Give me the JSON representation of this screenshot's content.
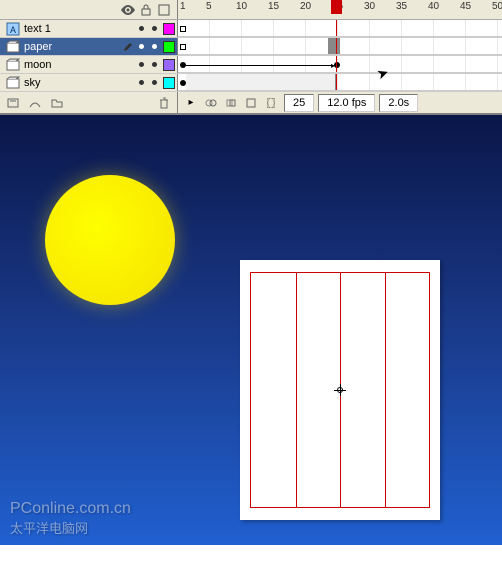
{
  "ruler": {
    "start": 1,
    "step": 5,
    "labels": [
      1,
      5,
      10,
      15,
      20,
      25,
      30,
      35,
      40,
      45,
      50
    ]
  },
  "playhead": {
    "frame": 25
  },
  "layers": [
    {
      "name": "text 1",
      "color": "#ff00ff",
      "selected": false,
      "type": "text",
      "hasPencil": false
    },
    {
      "name": "paper",
      "color": "#00ff00",
      "selected": true,
      "type": "symbol",
      "hasPencil": true
    },
    {
      "name": "moon",
      "color": "#9966ff",
      "selected": false,
      "type": "symbol",
      "hasPencil": false
    },
    {
      "name": "sky",
      "color": "#00ffff",
      "selected": false,
      "type": "symbol",
      "hasPencil": false
    }
  ],
  "status": {
    "current_frame": "25",
    "frame_rate": "12.0 fps",
    "elapsed": "2.0s"
  },
  "stage": {
    "moon_color": "#ffff00",
    "paper_line_color": "#c00"
  },
  "watermark": {
    "line1": "PConline.com.cn",
    "line2": "太平洋电脑网"
  }
}
